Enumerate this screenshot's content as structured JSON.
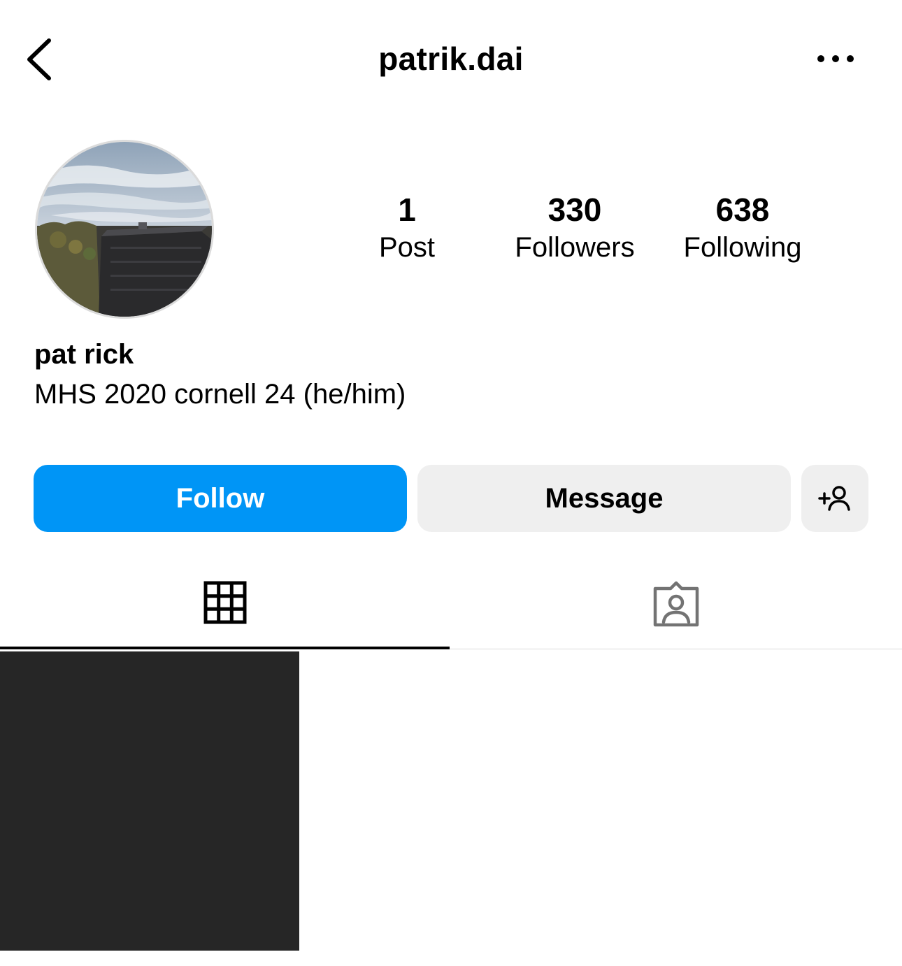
{
  "header": {
    "username": "patrik.dai",
    "back_icon": "chevron-left-icon",
    "more_icon": "more-horizontal-icon"
  },
  "profile": {
    "avatar_icon": "profile-photo-sky-building",
    "display_name": "pat rick",
    "bio": "MHS 2020 cornell 24 (he/him)"
  },
  "stats": {
    "posts": {
      "count": "1",
      "label": "Post"
    },
    "followers": {
      "count": "330",
      "label": "Followers"
    },
    "following": {
      "count": "638",
      "label": "Following"
    }
  },
  "actions": {
    "follow_label": "Follow",
    "message_label": "Message",
    "suggest_icon": "add-person-icon"
  },
  "tabs": [
    {
      "icon": "grid-icon",
      "active": true
    },
    {
      "icon": "tagged-person-icon",
      "active": false
    }
  ],
  "colors": {
    "accent": "#0095f6",
    "secondary_button": "#efefef",
    "text": "#000000",
    "divider": "#dbdbdb",
    "post_thumbnail": "#262626"
  },
  "posts": [
    {
      "thumbnail": "dark-photo"
    }
  ]
}
